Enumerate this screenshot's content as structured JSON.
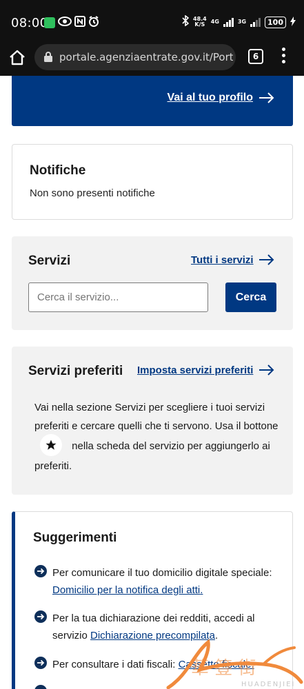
{
  "status_bar": {
    "time": "08:00",
    "net_speed_value": "48.4",
    "net_speed_unit": "K/S",
    "net1": "4G",
    "net2": "3G",
    "battery": "100"
  },
  "browser": {
    "url": "portale.agenziaentrate.gov.it/PortaleWeb",
    "tab_count": "6"
  },
  "profile": {
    "link_label": "Vai al tuo profilo"
  },
  "notifiche": {
    "title": "Notifiche",
    "empty_text": "Non sono presenti notifiche"
  },
  "servizi": {
    "title": "Servizi",
    "all_link": "Tutti i servizi",
    "search_placeholder": "Cerca il servizio...",
    "search_button": "Cerca"
  },
  "preferiti": {
    "title": "Servizi preferiti",
    "set_link": "Imposta servizi preferiti",
    "text_before": "Vai nella sezione Servizi per scegliere i tuoi servizi preferiti e cercare quelli che ti servono. Usa il bottone",
    "text_after": "nella scheda del servizio per aggiungerlo ai preferiti."
  },
  "suggerimenti": {
    "title": "Suggerimenti",
    "items": [
      {
        "text": "Per comunicare il tuo domicilio digitale speciale: ",
        "link": "Domicilio per la notifica degli atti",
        "suffix": "."
      },
      {
        "text": "Per la tua dichiarazione dei redditi, accedi al servizio ",
        "link": "Dichiarazione precompilata",
        "suffix": "."
      },
      {
        "text": "Per consultare i dati fiscali: ",
        "link": "Cassetto fiscale",
        "suffix": "."
      }
    ]
  },
  "watermark": {
    "text": "HUADENJIEI"
  },
  "colors": {
    "brand_blue": "#003882",
    "card_grey": "#f2f2f2",
    "status_bg": "#111111"
  }
}
